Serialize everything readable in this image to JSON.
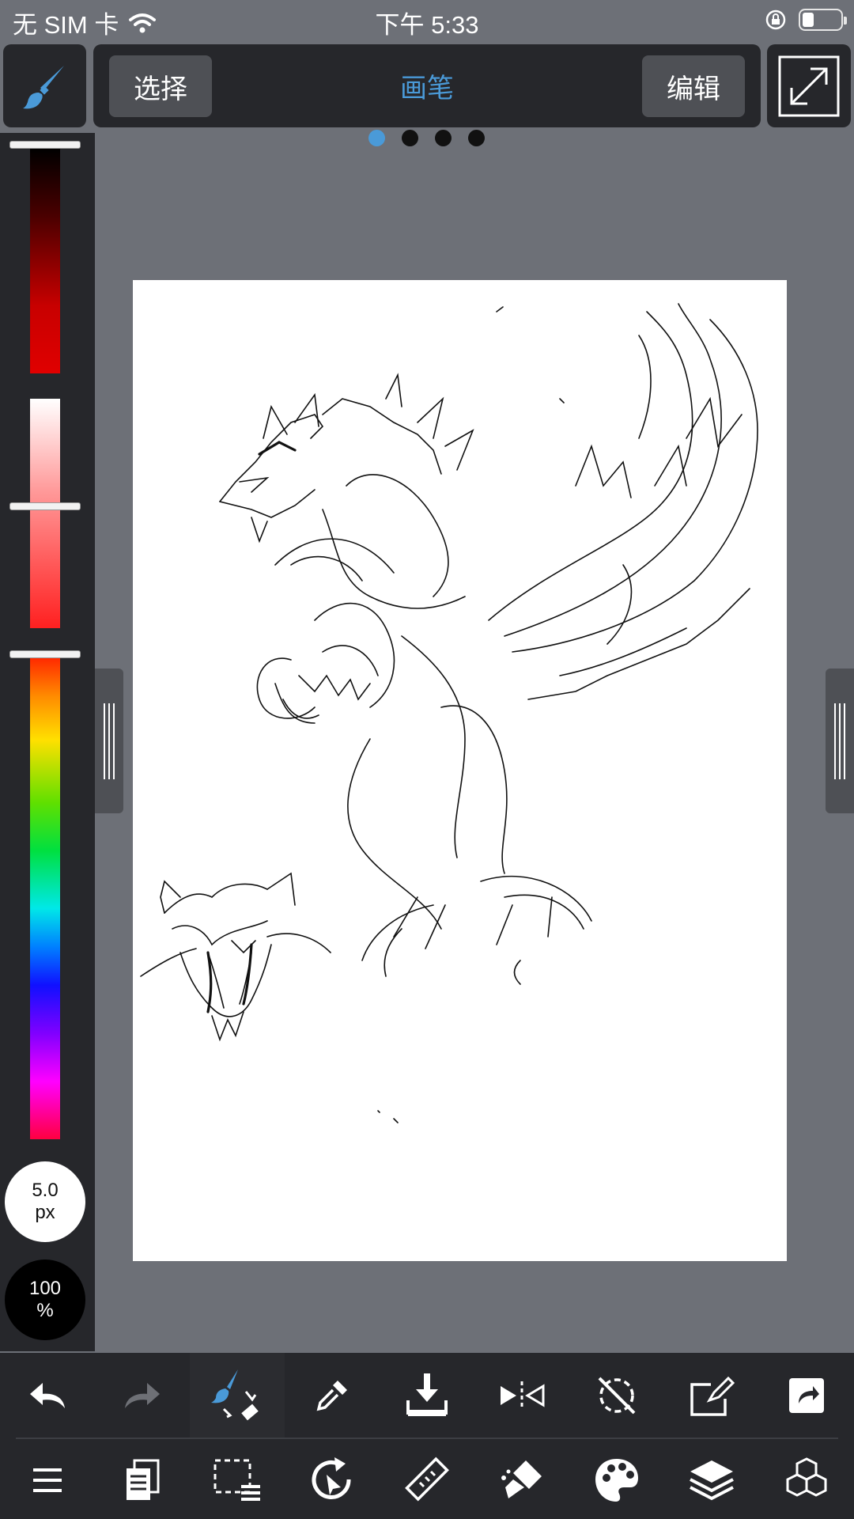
{
  "status_bar": {
    "carrier": "无 SIM 卡",
    "time": "下午 5:33"
  },
  "top_toolbar": {
    "select_label": "选择",
    "title": "画笔",
    "edit_label": "编辑",
    "page_count": 4,
    "active_page": 1
  },
  "left_panel": {
    "brush_size": "5.0",
    "brush_size_unit": "px",
    "opacity": "100",
    "opacity_unit": "%"
  },
  "bottom_toolbar": {
    "row1": [
      "undo-icon",
      "redo-icon",
      "brush-eraser-swap-icon",
      "eyedropper-icon",
      "download-icon",
      "flip-icon",
      "rotate-reset-icon",
      "transform-icon",
      "share-icon"
    ],
    "row2": [
      "menu-icon",
      "pages-icon",
      "selection-icon",
      "rotate-canvas-icon",
      "ruler-icon",
      "fill-tool-icon",
      "palette-icon",
      "layers-icon",
      "materials-icon"
    ]
  },
  "colors": {
    "accent": "#4a9ad8",
    "panel": "#26272b",
    "background": "#6d7077"
  }
}
